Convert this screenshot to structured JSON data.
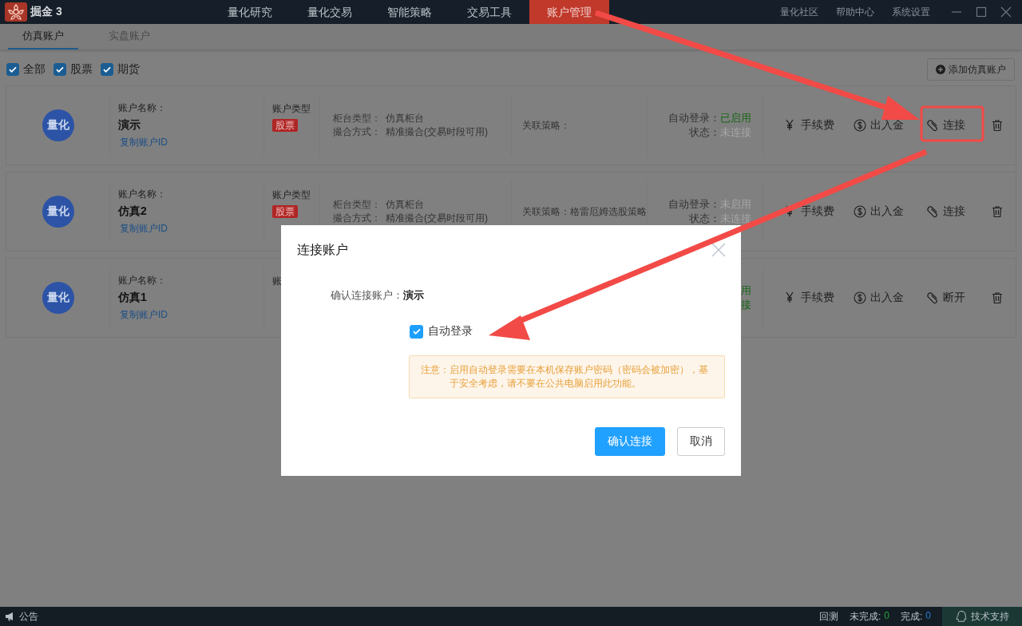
{
  "app": {
    "title": "掘金 3"
  },
  "nav": [
    {
      "label": "量化研究",
      "selected": false
    },
    {
      "label": "量化交易",
      "selected": false
    },
    {
      "label": "智能策略",
      "selected": false
    },
    {
      "label": "交易工具",
      "selected": false
    },
    {
      "label": "账户管理",
      "selected": true
    }
  ],
  "top_links": [
    "量化社区",
    "帮助中心",
    "系统设置"
  ],
  "tabs": [
    {
      "label": "仿真账户",
      "selected": true
    },
    {
      "label": "实盘账户",
      "selected": false
    }
  ],
  "filters": [
    {
      "label": "全部",
      "checked": true
    },
    {
      "label": "股票",
      "checked": true
    },
    {
      "label": "期货",
      "checked": true
    }
  ],
  "add_button": "添加仿真账户",
  "accounts": [
    {
      "avatar": "量化",
      "name_label": "账户名称：",
      "name": "演示",
      "copy_link": "复制账户ID",
      "type_label": "账户类型",
      "type_tag": "股票",
      "counter_label": "柜台类型：",
      "counter_value": "仿真柜台",
      "match_label": "撮合方式：",
      "match_value": "精准撮合(交易时段可用)",
      "strategy_label": "关联策略：",
      "auto_login_label": "自动登录：",
      "auto_login_value": "已启用",
      "auto_login_on": true,
      "status_label": "状态：",
      "status_value": "未连接",
      "connected": false,
      "actions": [
        {
          "kind": "fee",
          "label": "手续费"
        },
        {
          "kind": "funds",
          "label": "出入金"
        },
        {
          "kind": "link",
          "label": "连接"
        },
        {
          "kind": "delete"
        }
      ]
    },
    {
      "avatar": "量化",
      "name_label": "账户名称：",
      "name": "仿真2",
      "copy_link": "复制账户ID",
      "type_label": "账户类型",
      "type_tag": "股票",
      "counter_label": "柜台类型：",
      "counter_value": "仿真柜台",
      "match_label": "撮合方式：",
      "match_value": "精准撮合(交易时段可用)",
      "strategy_label": "关联策略：",
      "strategy_value": "格雷厄姆选股策略",
      "auto_login_label": "自动登录：",
      "auto_login_value": "未启用",
      "auto_login_on": false,
      "status_label": "状态：",
      "status_value": "未连接",
      "connected": false,
      "actions": [
        {
          "kind": "fee",
          "label": "手续费"
        },
        {
          "kind": "funds",
          "label": "出入金"
        },
        {
          "kind": "link",
          "label": "连接"
        },
        {
          "kind": "delete"
        }
      ]
    },
    {
      "avatar": "量化",
      "name_label": "账户名称：",
      "name": "仿真1",
      "copy_link": "复制账户ID",
      "type_label": "账",
      "auto_login_value": "用",
      "auto_login_on": true,
      "status_value": "接",
      "connected": true,
      "actions": [
        {
          "kind": "fee",
          "label": "手续费"
        },
        {
          "kind": "funds",
          "label": "出入金"
        },
        {
          "kind": "link",
          "label": "断开"
        },
        {
          "kind": "delete"
        }
      ]
    }
  ],
  "dialog": {
    "title": "连接账户",
    "confirm_label": "确认连接账户：",
    "confirm_value": "演示",
    "auto_login": {
      "label": "自动登录",
      "checked": true
    },
    "notice_label": "注意：",
    "notice_text": "启用自动登录需要在本机保存账户密码（密码会被加密），基于安全考虑，请不要在公共电脑启用此功能。",
    "buttons": [
      {
        "label": "确认连接",
        "kind": "primary"
      },
      {
        "label": "取消",
        "kind": "default"
      }
    ]
  },
  "status_bar": {
    "announcement": "公告",
    "backtest": "回测",
    "counters": [
      {
        "label": "未完成:",
        "count": "0",
        "kind": "pending"
      },
      {
        "label": "完成:",
        "count": "0",
        "kind": "done"
      }
    ],
    "support": "技术支持"
  }
}
